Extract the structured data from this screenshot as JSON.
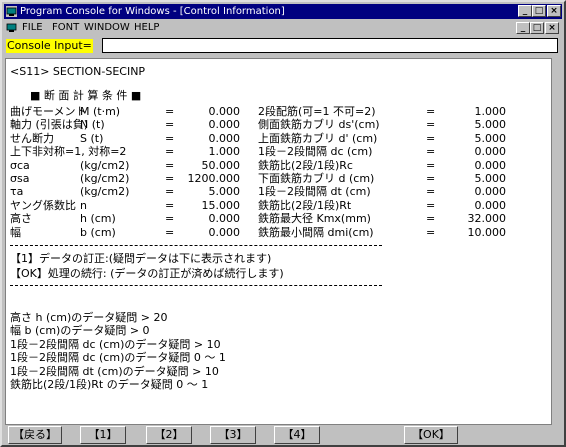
{
  "window": {
    "title": "Program Console for Windows - [Control Information]"
  },
  "titlebar": {
    "min": "_",
    "max": "□",
    "close": "×"
  },
  "menu": {
    "items": [
      "FILE",
      "FONT",
      "WINDOW",
      "HELP"
    ],
    "child_min": "_",
    "child_max": "□",
    "child_close": "×"
  },
  "console": {
    "label": "Console Input=",
    "value": ""
  },
  "content": {
    "heading_line": "<S11>    SECTION-SECINP",
    "section_title": "■ 断 面 計 算 条 件 ■",
    "params": [
      {
        "l1": "曲げモーメント",
        "u1": "M (t·m)",
        "eq1": "=",
        "v1": "0.000",
        "l2": "2段配筋(可=1 不可=2)",
        "eq2": "=",
        "v2": "1.000"
      },
      {
        "l1": "軸力 (引張は負)",
        "u1": "N (t)",
        "eq1": "=",
        "v1": "0.000",
        "l2": "側面鉄筋カブリ ds'(cm)",
        "eq2": "=",
        "v2": "5.000"
      },
      {
        "l1": "せん断力",
        "u1": "S (t)",
        "eq1": "=",
        "v1": "0.000",
        "l2": "上面鉄筋カブリ  d' (cm)",
        "eq2": "=",
        "v2": "5.000"
      },
      {
        "l1": "上下非対称=1, 対称=2",
        "u1": "",
        "eq1": "=",
        "v1": "1.000",
        "l2": "1段－2段間隔 dc (cm)",
        "eq2": "=",
        "v2": "0.000"
      },
      {
        "l1": "σca",
        "u1": "(kg/cm2)",
        "eq1": "=",
        "v1": "50.000",
        "l2": "鉄筋比(2段/1段)Rc",
        "eq2": "=",
        "v2": "0.000"
      },
      {
        "l1": "σsa",
        "u1": "(kg/cm2)",
        "eq1": "=",
        "v1": "1200.000",
        "l2": "下面鉄筋カブリ  d (cm)",
        "eq2": "=",
        "v2": "5.000"
      },
      {
        "l1": "τa",
        "u1": "(kg/cm2)",
        "eq1": "=",
        "v1": "5.000",
        "l2": "1段－2段間隔 dt (cm)",
        "eq2": "=",
        "v2": "0.000"
      },
      {
        "l1": "ヤング係数比",
        "u1": "n",
        "eq1": "=",
        "v1": "15.000",
        "l2": "鉄筋比(2段/1段)Rt",
        "eq2": "=",
        "v2": "0.000"
      },
      {
        "l1": "高さ",
        "u1": "h (cm)",
        "eq1": "=",
        "v1": "0.000",
        "l2": "鉄筋最大径    Kmx(mm)",
        "eq2": "=",
        "v2": "32.000"
      },
      {
        "l1": "幅",
        "u1": "b (cm)",
        "eq1": "=",
        "v1": "0.000",
        "l2": "鉄筋最小間隔  dmi(cm)",
        "eq2": "=",
        "v2": "10.000"
      }
    ],
    "option1": "【1】データの訂正:(疑問データは下に表示されます)",
    "option_ok": "【OK】処理の続行: (データの訂正が済めば続行します)",
    "errors": [
      "高さ          h (cm)のデータ疑問   > 20",
      "幅            b (cm)のデータ疑問   > 0",
      "1段－2段間隔  dc (cm)のデータ疑問   > 10",
      "1段－2段間隔  dc (cm)のデータ疑問   0 ～ 1",
      "1段－2段間隔  dt (cm)のデータ疑問   > 10",
      "鉄筋比(2段/1段)Rt     のデータ疑問   0 ～ 1"
    ]
  },
  "fkeys": {
    "back": "【戻る】",
    "k1": "【1】",
    "k2": "【2】",
    "k3": "【3】",
    "k4": "【4】",
    "ok": "【OK】"
  }
}
